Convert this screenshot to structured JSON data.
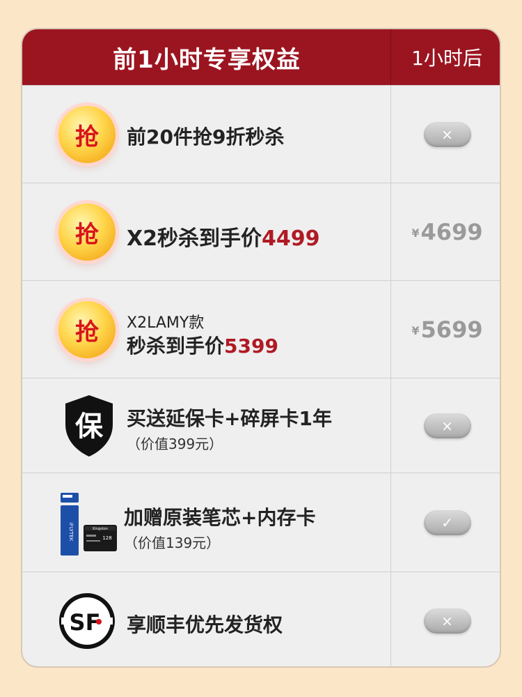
{
  "header": {
    "left_title": "前1小时专享权益",
    "right_title": "1小时后"
  },
  "rows": [
    {
      "badge": "抢",
      "title": "前20件抢9折秒杀",
      "after": "×",
      "after_icon": "close-icon"
    },
    {
      "badge": "抢",
      "title_prefix": "X2秒杀到手价",
      "title_price": "4499",
      "after_currency": "¥",
      "after_price": "4699"
    },
    {
      "badge": "抢",
      "line1": "X2LAMY款",
      "title_prefix": "秒杀到手价",
      "title_price": "5399",
      "after_currency": "¥",
      "after_price": "5699"
    },
    {
      "icon_char": "保",
      "title": "买送延保卡+碎屏卡1年",
      "subtitle": "（价值399元）",
      "after": "×",
      "after_icon": "close-icon"
    },
    {
      "title": "加赠原装笔芯+内存卡",
      "subtitle": "（价值139元）",
      "after": "✓",
      "after_icon": "check-icon",
      "pen_brand": "iFLYTEK",
      "card_brand": "Kingston",
      "card_capacity": "128"
    },
    {
      "title": "享顺丰优先发货权",
      "after": "×",
      "after_icon": "close-icon",
      "logo_text": "SF"
    }
  ],
  "colors": {
    "header_bg": "#9b1520",
    "price_red": "#b01a24",
    "page_bg": "#fbe6c8",
    "badge_text": "#d8141b"
  }
}
